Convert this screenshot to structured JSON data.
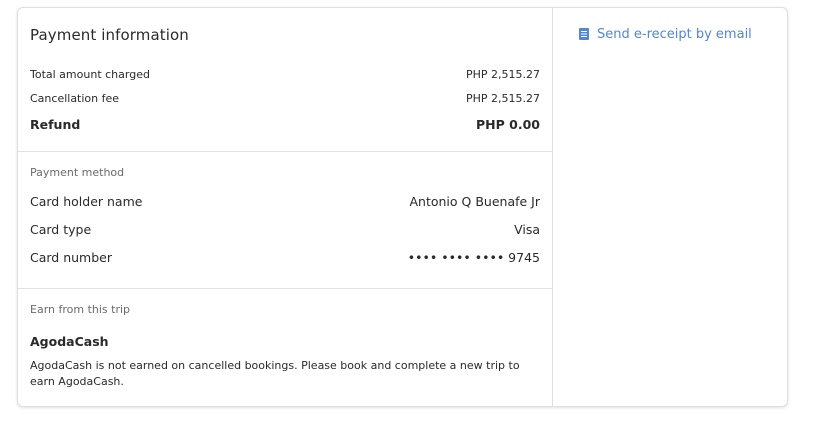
{
  "payment": {
    "title": "Payment information",
    "total_label": "Total amount charged",
    "total_value": "PHP 2,515.27",
    "fee_label": "Cancellation fee",
    "fee_value": "PHP 2,515.27",
    "refund_label": "Refund",
    "refund_value": "PHP 0.00"
  },
  "method": {
    "heading": "Payment method",
    "holder_label": "Card holder name",
    "holder_value": "Antonio Q Buenafe Jr",
    "type_label": "Card type",
    "type_value": "Visa",
    "number_label": "Card number",
    "number_value": "•••• •••• •••• 9745"
  },
  "earn": {
    "heading": "Earn from this trip",
    "title": "AgodaCash",
    "description": "AgodaCash is not earned on cancelled bookings. Please book and complete a new trip to earn AgodaCash."
  },
  "actions": {
    "receipt_label": "Send e-receipt by email",
    "receipt_icon": "document-icon",
    "link_color": "#5286d8"
  }
}
